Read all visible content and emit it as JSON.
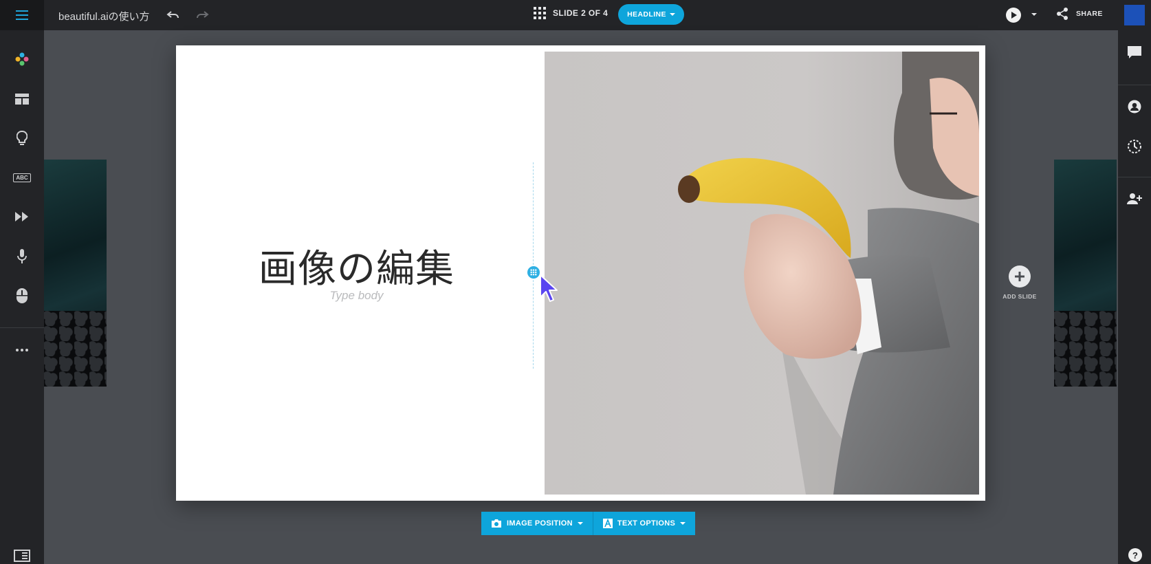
{
  "header": {
    "doc_title": "beautiful.aiの使い方",
    "slide_counter": "SLIDE 2 OF 4",
    "layout_button": "HEADLINE",
    "share_label": "SHARE"
  },
  "slide": {
    "headline": "画像の編集",
    "body_placeholder": "Type body"
  },
  "add_slide_label": "ADD SLIDE",
  "bottom_toolbar": {
    "image_position": "IMAGE POSITION",
    "text_options": "TEXT OPTIONS"
  },
  "help_label": "?",
  "left_sidebar": {
    "abc_label": "ABC"
  },
  "icons": [
    "menu-icon",
    "undo-icon",
    "redo-icon",
    "grid-icon",
    "play-icon",
    "share-icon",
    "palette-icon",
    "layout-icon",
    "idea-icon",
    "abc-icon",
    "fast-forward-icon",
    "microphone-icon",
    "mouse-icon",
    "more-icon",
    "panel-icon",
    "comment-icon",
    "user-icon",
    "history-icon",
    "add-user-icon",
    "help-icon",
    "camera-icon",
    "text-icon"
  ],
  "colors": {
    "accent": "#0ea5db",
    "topbar": "#232427",
    "canvas": "#4a4d52"
  }
}
